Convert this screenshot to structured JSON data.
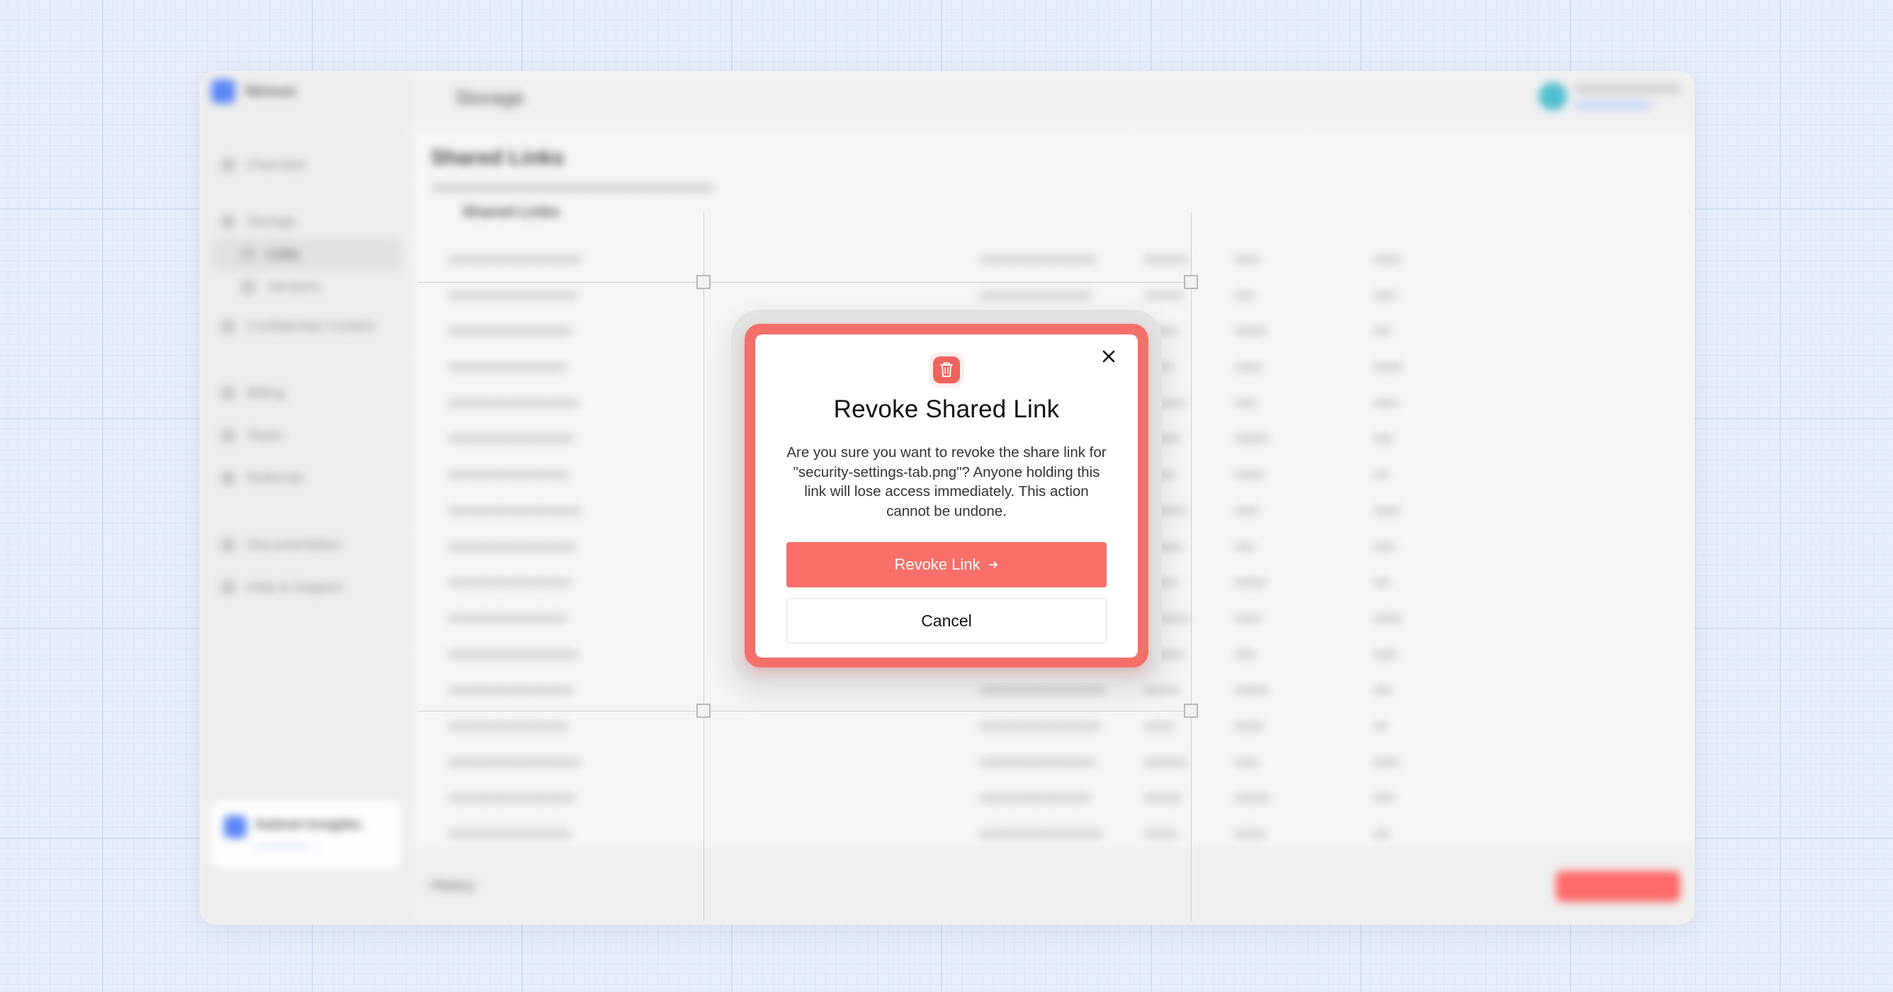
{
  "app": {
    "brand_name": "Nexus",
    "breadcrumb": "Storage",
    "page_title": "Shared Links",
    "active_tab": "Shared Links",
    "sidebar": {
      "items": [
        {
          "label": "Overview",
          "icon": "home-icon"
        },
        {
          "label": "Storage",
          "icon": "database-icon"
        },
        {
          "label": "Links",
          "icon": "link-icon",
          "active": true
        },
        {
          "label": "Versions",
          "icon": "history-icon"
        },
        {
          "label": "Confidential Content",
          "icon": "lock-icon"
        },
        {
          "label": "Billing",
          "icon": "card-icon"
        },
        {
          "label": "Tasks",
          "icon": "check-icon"
        },
        {
          "label": "Referrals",
          "icon": "gift-icon"
        },
        {
          "label": "Documentation",
          "icon": "book-icon"
        },
        {
          "label": "Help & Support",
          "icon": "help-icon"
        }
      ]
    },
    "org_card": {
      "name": "Subnet Insights"
    },
    "footer": {
      "label": "History"
    }
  },
  "modal": {
    "title": "Revoke Shared Link",
    "body": "Are you sure you want to revoke the share link for \"security-settings-tab.png\"? Anyone holding this link will lose access immediately. This action cannot be undone.",
    "primary_label": "Revoke Link",
    "primary_icon": "arrow-right-icon",
    "secondary_label": "Cancel",
    "close_icon": "close-icon",
    "header_icon": "trash-icon",
    "accent_color": "#f36f6a"
  }
}
